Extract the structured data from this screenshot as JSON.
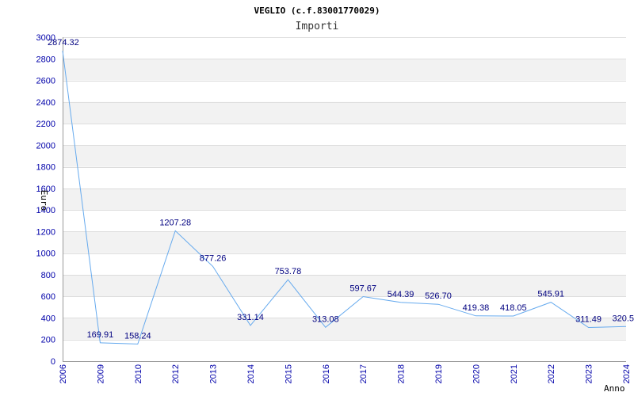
{
  "chart_data": {
    "type": "line",
    "title": "VEGLIO (c.f.83001770029)",
    "subtitle": "Importi",
    "ylabel": "Euro",
    "xlabel": "Anno",
    "categories": [
      "2006",
      "2009",
      "2010",
      "2012",
      "2013",
      "2014",
      "2015",
      "2016",
      "2017",
      "2018",
      "2019",
      "2020",
      "2021",
      "2022",
      "2023",
      "2024"
    ],
    "series": [
      {
        "values": [
          2874.32,
          169.91,
          158.24,
          1207.28,
          877.26,
          331.14,
          753.78,
          313.08,
          597.67,
          544.39,
          526.7,
          419.38,
          418.05,
          545.91,
          311.49,
          320.5
        ]
      }
    ],
    "data_labels": [
      "2874.32",
      "169.91",
      "158.24",
      "1207.28",
      "877.26",
      "331.14",
      "753.78",
      "313.08",
      "597.67",
      "544.39",
      "526.70",
      "419.38",
      "418.05",
      "545.91",
      "311.49",
      "320.5"
    ],
    "ylim": [
      0,
      3000
    ],
    "yticks": [
      "0",
      "200",
      "400",
      "600",
      "800",
      "1000",
      "1200",
      "1400",
      "1600",
      "1800",
      "2000",
      "2200",
      "2400",
      "2600",
      "2800",
      "3000"
    ],
    "grid": "horizontal alternating bands",
    "colors": {
      "line": "#66aaee",
      "band": "#f2f2f2",
      "tick": "#0000aa",
      "label": "#000080"
    }
  }
}
